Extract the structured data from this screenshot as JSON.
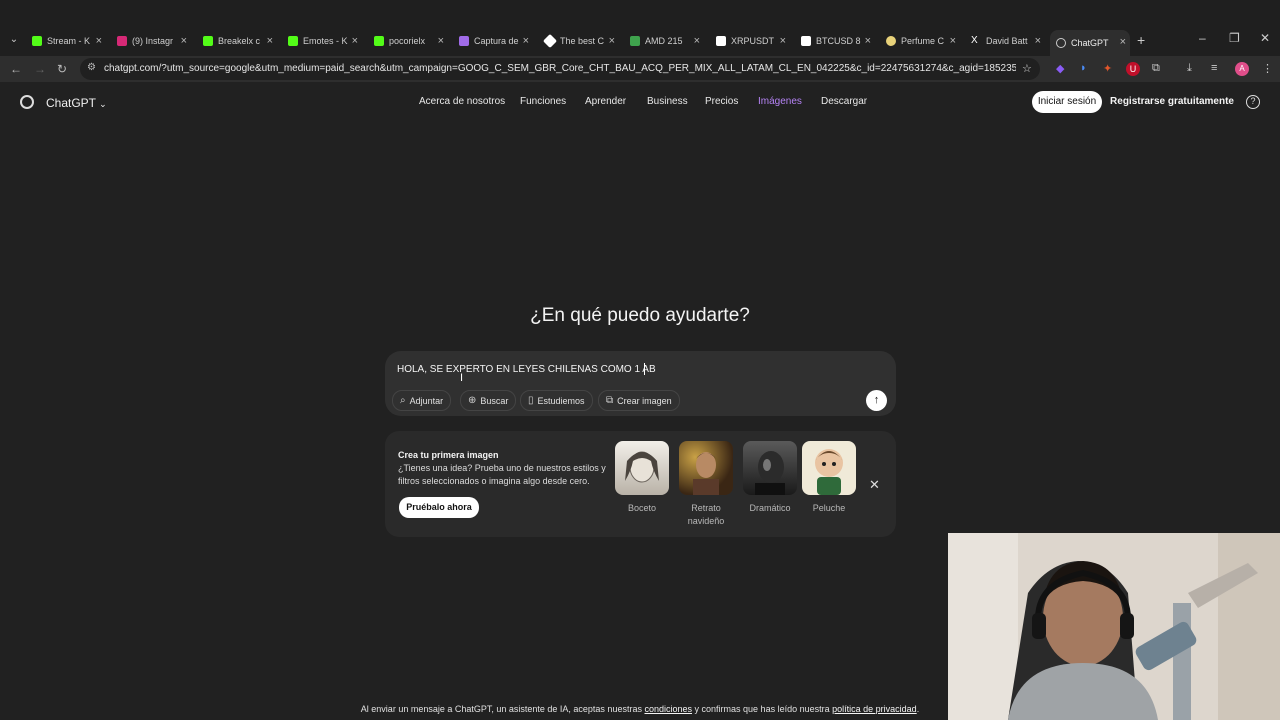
{
  "browser": {
    "tabs": [
      {
        "label": "Stream - K",
        "color": "#53fc18"
      },
      {
        "label": "(9) Instagr",
        "color": "#d62976"
      },
      {
        "label": "Breakelx c",
        "color": "#53fc18"
      },
      {
        "label": "Emotes - K",
        "color": "#53fc18"
      },
      {
        "label": "pocorielx",
        "color": "#53fc18"
      },
      {
        "label": "Captura de",
        "color": "#a06be8"
      },
      {
        "label": "The best C",
        "color": "#ffffff"
      },
      {
        "label": "AMD 215",
        "color": "#3fa34d"
      },
      {
        "label": "XRPUSDT",
        "color": "#ffffff"
      },
      {
        "label": "BTCUSD 8",
        "color": "#ffffff"
      },
      {
        "label": "Perfume C",
        "color": "#e8d27a"
      },
      {
        "label": "David Batt",
        "color": "#ffffff"
      },
      {
        "label": "ChatGPT",
        "color": "#cccccc"
      }
    ],
    "url": "chatgpt.com/?utm_source=google&utm_medium=paid_search&utm_campaign=GOOG_C_SEM_GBR_Core_CHT_BAU_ACQ_PER_MIX_ALL_LATAM_CL_EN_042225&c_id=22475631274&c_agid=185235703384&c_crid=7478..."
  },
  "header": {
    "brand": "ChatGPT",
    "nav": [
      "Acerca de nosotros",
      "Funciones",
      "Aprender",
      "Business",
      "Precios",
      "Imágenes",
      "Descargar"
    ],
    "login": "Iniciar sesión",
    "signup": "Registrarse gratuitamente"
  },
  "main": {
    "headline": "¿En qué puedo ayudarte?",
    "input_value": "HOLA, SE EXPERTO EN LEYES CHILENAS COMO 1 AB",
    "buttons": [
      "Adjuntar",
      "Buscar",
      "Estudiemos",
      "Crear imagen"
    ]
  },
  "promo": {
    "title": "Crea tu primera imagen",
    "description": "¿Tienes una idea? Prueba uno de nuestros estilos y filtros seleccionados o imagina algo desde cero.",
    "cta": "Pruébalo ahora",
    "styles": [
      "Boceto",
      "Retrato navideño",
      "Dramático",
      "Peluche"
    ]
  },
  "footer": {
    "prefix": "Al enviar un mensaje a ChatGPT, un asistente de IA, aceptas nuestras",
    "terms": "condiciones",
    "middle": "y confirmas que has leído nuestra",
    "privacy": "política de privacidad",
    "suffix": "."
  },
  "colors": {
    "background": "#212121",
    "accent": "#b583f5"
  }
}
